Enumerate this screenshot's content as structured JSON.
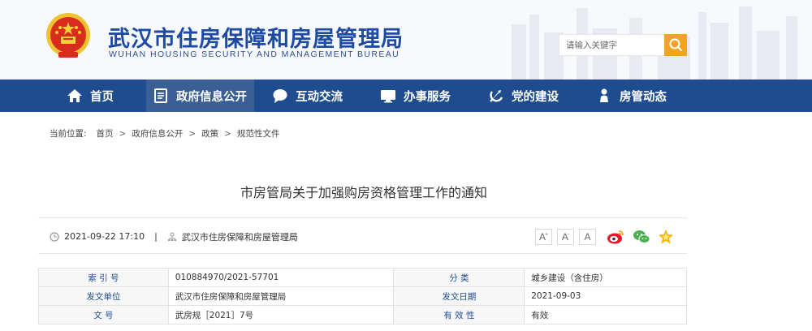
{
  "header": {
    "title": "武汉市住房保障和房屋管理局",
    "subtitle": "WUHAN HOUSING SECURITY AND MANAGEMENT BUREAU",
    "search_placeholder": "请输入关键字"
  },
  "nav": {
    "items": [
      {
        "label": "首页",
        "icon": "home-icon"
      },
      {
        "label": "政府信息公开",
        "icon": "document-icon",
        "active": true
      },
      {
        "label": "互动交流",
        "icon": "chat-icon"
      },
      {
        "label": "办事服务",
        "icon": "monitor-icon"
      },
      {
        "label": "党的建设",
        "icon": "party-emblem-icon"
      },
      {
        "label": "房管动态",
        "icon": "person-icon"
      }
    ]
  },
  "breadcrumb": {
    "lead": "当前位置:",
    "items": [
      "首页",
      "政府信息公开",
      "政策",
      "规范性文件"
    ],
    "separator": ">"
  },
  "article": {
    "title": "市房管局关于加强购房资格管理工作的通知",
    "datetime": "2021-09-22 17:10",
    "divider": "|",
    "source": "武汉市住房保障和房屋管理局",
    "font_buttons": [
      "A",
      "A",
      "A"
    ],
    "font_button_marks": [
      "+",
      "-",
      ""
    ]
  },
  "info_table": {
    "rows": [
      [
        {
          "k": "索  引  号",
          "v": "010884970/2021-57701"
        },
        {
          "k": "分        类",
          "v": "城乡建设（含住房）"
        }
      ],
      [
        {
          "k": "发文单位",
          "v": "武汉市住房保障和房屋管理局"
        },
        {
          "k": "发文日期",
          "v": "2021-09-03"
        }
      ],
      [
        {
          "k": "文        号",
          "v": "武房规［2021］7号"
        },
        {
          "k": "有  效  性",
          "v": "有效"
        }
      ]
    ]
  },
  "colors": {
    "brand_blue": "#1e4c8e",
    "title_blue": "#1d4aa3",
    "search_orange": "#f2a225",
    "weibo_red": "#e6162d",
    "wechat_green": "#4caf50",
    "star_yellow": "#f5b400"
  }
}
